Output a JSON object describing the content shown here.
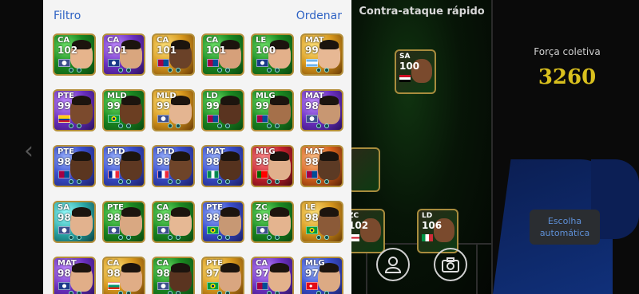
{
  "header": {
    "filter_label": "Filtro",
    "sort_label": "Ordenar"
  },
  "formation": {
    "tactic": "Contra-ataque rápido",
    "strength_label": "Força coletiva",
    "strength_value": "3260",
    "auto_button_label": "Escolha automática"
  },
  "pitch_cards": [
    {
      "position": "SA",
      "rating": "100",
      "flag": "egypt"
    },
    {
      "position": "ZC",
      "rating": "102",
      "flag": "england"
    },
    {
      "position": "LD",
      "rating": "106",
      "flag": "italy"
    }
  ],
  "players": [
    {
      "position": "CA",
      "rating": "102",
      "bg": "green",
      "skin": "#e6b48c",
      "flag": "club"
    },
    {
      "position": "CA",
      "rating": "101",
      "bg": "purple",
      "skin": "#d9a67e",
      "flag": "inter"
    },
    {
      "position": "CA",
      "rating": "101",
      "bg": "gold",
      "skin": "#6a4128",
      "flag": "barca"
    },
    {
      "position": "CA",
      "rating": "101",
      "bg": "green",
      "skin": "#d6a07a",
      "flag": "barca"
    },
    {
      "position": "LE",
      "rating": "100",
      "bg": "green",
      "skin": "#e3b08a",
      "flag": "inter"
    },
    {
      "position": "MAT",
      "rating": "99",
      "bg": "gold",
      "skin": "#e7b894",
      "flag": "argentina"
    },
    {
      "position": "PTE",
      "rating": "99",
      "bg": "purple",
      "skin": "#7b4a2d",
      "flag": "colombia"
    },
    {
      "position": "MLD",
      "rating": "99",
      "bg": "green",
      "skin": "#6b3e22",
      "flag": "brazil"
    },
    {
      "position": "MLD",
      "rating": "99",
      "bg": "gold",
      "skin": "#e4b591",
      "flag": "club"
    },
    {
      "position": "LD",
      "rating": "99",
      "bg": "green",
      "skin": "#5a3420",
      "flag": "barca"
    },
    {
      "position": "MLG",
      "rating": "99",
      "bg": "green",
      "skin": "#a5704a",
      "flag": "barca"
    },
    {
      "position": "MAT",
      "rating": "98",
      "bg": "purple",
      "skin": "#c89772",
      "flag": "club"
    },
    {
      "position": "PTE",
      "rating": "98",
      "bg": "blue",
      "skin": "#5b3620",
      "flag": "barca"
    },
    {
      "position": "PTD",
      "rating": "98",
      "bg": "blue",
      "skin": "#5e3822",
      "flag": "france"
    },
    {
      "position": "PTD",
      "rating": "98",
      "bg": "blue",
      "skin": "#6e4429",
      "flag": "france"
    },
    {
      "position": "MAT",
      "rating": "98",
      "bg": "blue",
      "skin": "#55321e",
      "flag": "nigeria"
    },
    {
      "position": "MLG",
      "rating": "98",
      "bg": "red",
      "skin": "#e1b08c",
      "flag": "portugal"
    },
    {
      "position": "MAT",
      "rating": "98",
      "bg": "orange",
      "skin": "#5c3a24",
      "flag": "barca"
    },
    {
      "position": "SA",
      "rating": "98",
      "bg": "teal",
      "skin": "#e2b28e",
      "flag": "club"
    },
    {
      "position": "PTE",
      "rating": "98",
      "bg": "green",
      "skin": "#d9a882",
      "flag": "club"
    },
    {
      "position": "CA",
      "rating": "98",
      "bg": "green",
      "skin": "#e6b894",
      "flag": "club"
    },
    {
      "position": "PTE",
      "rating": "98",
      "bg": "blue",
      "skin": "#c79874",
      "flag": "brazil"
    },
    {
      "position": "ZC",
      "rating": "98",
      "bg": "green",
      "skin": "#e4b48f",
      "flag": "club"
    },
    {
      "position": "LE",
      "rating": "98",
      "bg": "gold",
      "skin": "#8b5a38",
      "flag": "brazil"
    },
    {
      "position": "MAT",
      "rating": "98",
      "bg": "purple",
      "skin": "#e1ae88",
      "flag": "inter"
    },
    {
      "position": "CA",
      "rating": "98",
      "bg": "gold",
      "skin": "#e0ad86",
      "flag": "bulgaria"
    },
    {
      "position": "CA",
      "rating": "98",
      "bg": "green",
      "skin": "#5a3420",
      "flag": "club"
    },
    {
      "position": "PTE",
      "rating": "97",
      "bg": "gold",
      "skin": "#d9a680",
      "flag": "brazil"
    },
    {
      "position": "CA",
      "rating": "97",
      "bg": "purple",
      "skin": "#e3b28c",
      "flag": "barca"
    },
    {
      "position": "MLG",
      "rating": "97",
      "bg": "blue",
      "skin": "#dcaa84",
      "flag": "turkey"
    }
  ],
  "colors": {
    "accent_blue": "#2f63c4",
    "strength_yellow": "#d9c01e",
    "card_border_gold": "#b48f3a"
  }
}
